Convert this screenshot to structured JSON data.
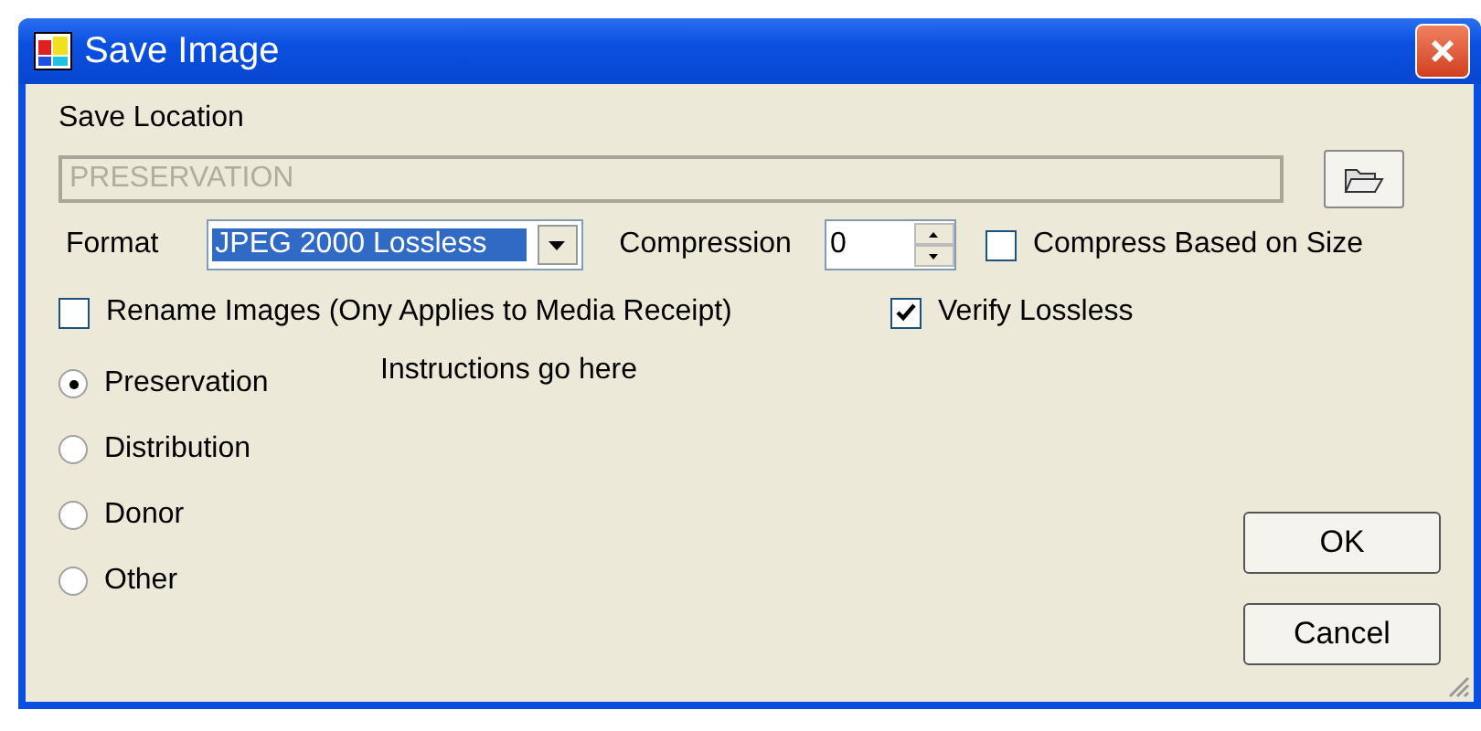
{
  "window": {
    "title": "Save Image"
  },
  "save_location": {
    "label": "Save Location",
    "value": "PRESERVATION",
    "disabled": true
  },
  "format": {
    "label": "Format",
    "value": "JPEG 2000 Lossless"
  },
  "compression": {
    "label": "Compression",
    "value": "0"
  },
  "checkboxes": [
    {
      "label": "Compress Based on Size",
      "checked": false
    },
    {
      "label": "Rename Images (Ony Applies to Media Receipt)",
      "checked": false
    },
    {
      "label": "Verify Lossless",
      "checked": true
    }
  ],
  "radios": [
    {
      "label": "Preservation",
      "selected": true
    },
    {
      "label": "Distribution",
      "selected": false
    },
    {
      "label": "Donor",
      "selected": false
    },
    {
      "label": "Other",
      "selected": false
    }
  ],
  "instructions": "Instructions go here",
  "buttons": [
    "OK",
    "Cancel"
  ]
}
